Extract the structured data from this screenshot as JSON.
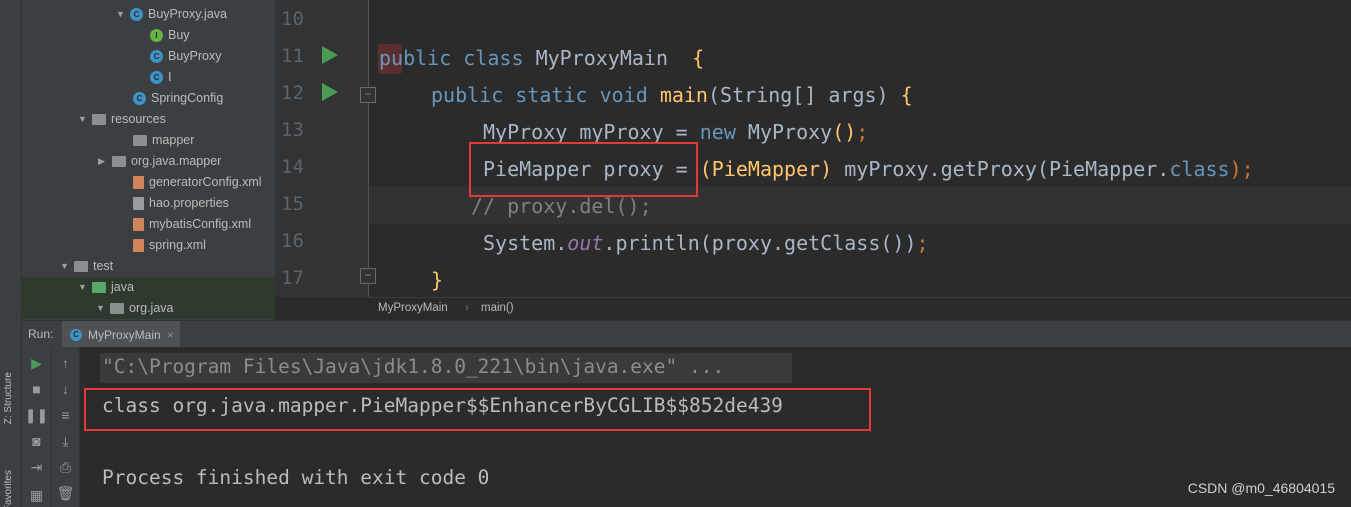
{
  "tool_strip": {
    "structure_label": "Z: Structure",
    "favorites_label": "Favorites"
  },
  "project_tree": {
    "items": [
      {
        "label": "BuyProxy.java",
        "icon": "class-file-icon"
      },
      {
        "label": "Buy",
        "icon": "interface-icon"
      },
      {
        "label": "BuyProxy",
        "icon": "class-icon"
      },
      {
        "label": "I",
        "icon": "class-icon"
      },
      {
        "label": "SpringConfig",
        "icon": "class-icon"
      },
      {
        "label": "resources",
        "icon": "resources-folder-icon"
      },
      {
        "label": "mapper",
        "icon": "folder-icon"
      },
      {
        "label": "org.java.mapper",
        "icon": "package-icon"
      },
      {
        "label": "generatorConfig.xml",
        "icon": "xml-file-icon"
      },
      {
        "label": "hao.properties",
        "icon": "properties-file-icon"
      },
      {
        "label": "mybatisConfig.xml",
        "icon": "xml-file-icon"
      },
      {
        "label": "spring.xml",
        "icon": "xml-file-icon"
      },
      {
        "label": "test",
        "icon": "folder-icon"
      },
      {
        "label": "java",
        "icon": "source-folder-icon"
      },
      {
        "label": "org.java",
        "icon": "package-icon"
      }
    ]
  },
  "editor": {
    "line_numbers": [
      "10",
      "11",
      "12",
      "13",
      "14",
      "15",
      "16",
      "17"
    ],
    "code": {
      "l11": {
        "kw1": "public",
        "kw2": "class",
        "name": "MyProxyMain",
        "brace": "{"
      },
      "l12": {
        "kw1": "public",
        "kw2": "static",
        "kw3": "void",
        "fn": "main",
        "params": "(String[] args)",
        "brace": "{"
      },
      "l13": {
        "type": "MyProxy myProxy",
        "eq": " = ",
        "kw": "new",
        "ctor": " MyProxy",
        "paren": "()",
        "semi": ";"
      },
      "l14": {
        "decl": "PieMapper proxy",
        "eq": " = ",
        "cast": "(PieMapper)",
        "call": " myProxy.getProxy(PieMapper.",
        "kw": "class",
        "end": ");"
      },
      "l15": {
        "comment_mark": "//",
        "comment": " proxy.del();"
      },
      "l16": {
        "obj": "System.",
        "out": "out",
        "call": ".println(proxy.getClass())",
        "semi": ";"
      },
      "l17": {
        "brace": "}"
      }
    },
    "breadcrumb": [
      "MyProxyMain",
      "main()"
    ]
  },
  "run_window": {
    "run_label": "Run:",
    "tab_label": "MyProxyMain",
    "console": {
      "cmd": "\"C:\\Program Files\\Java\\jdk1.8.0_221\\bin\\java.exe\" ...",
      "output": "class org.java.mapper.PieMapper$$EnhancerByCGLIB$$852de439",
      "finished": "Process finished with exit code 0"
    }
  },
  "watermark": "CSDN @m0_46804015",
  "colors": {
    "keyword": "#cc7832",
    "function": "#ffc66d",
    "highlight_box": "#e53935",
    "run_green": "#499c54"
  }
}
